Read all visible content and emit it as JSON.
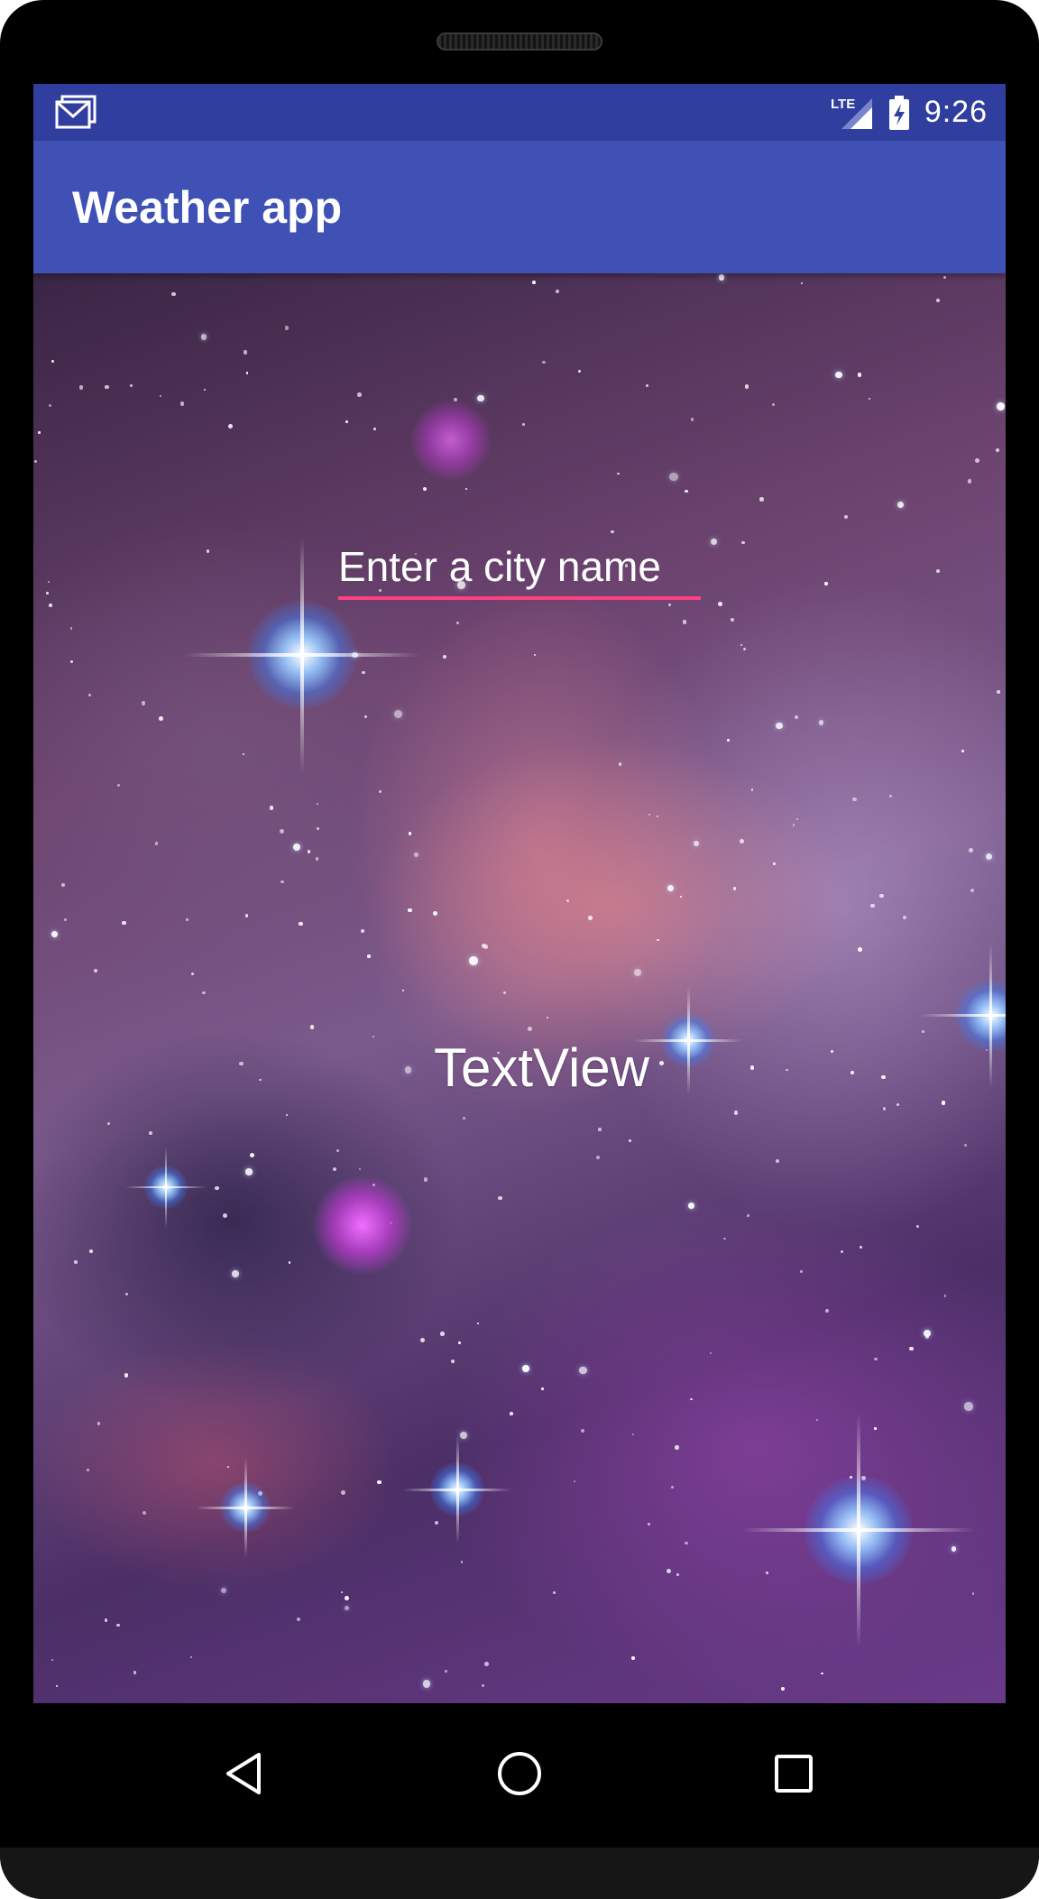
{
  "status_bar": {
    "time": "9:26",
    "network_label": "LTE",
    "notification_icon": "gmail-icon",
    "signal_icon": "cellular-signal-icon",
    "battery_icon": "battery-charging-icon",
    "color": "#303f9f"
  },
  "app_bar": {
    "title": "Weather app",
    "color": "#3f51b5"
  },
  "main": {
    "city_input": {
      "placeholder": "Enter a city name",
      "value": "",
      "underline_color": "#ff4081"
    },
    "result_text": "TextView",
    "background": "space-nebula-image"
  },
  "nav_bar": {
    "back_icon": "back-triangle-icon",
    "home_icon": "home-circle-icon",
    "recents_icon": "recents-square-icon"
  }
}
